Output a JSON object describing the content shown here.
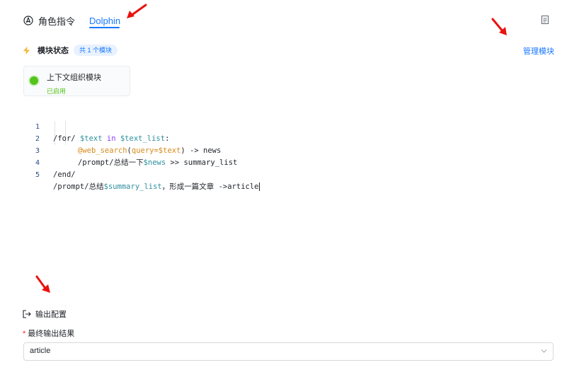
{
  "tabs": {
    "role_label": "角色指令",
    "dolphin_label": "Dolphin"
  },
  "modules": {
    "title": "模块状态",
    "badge": "共 1 个模块",
    "manage_label": "管理模块",
    "card": {
      "name": "上下文组织模块",
      "status": "已启用"
    }
  },
  "code": {
    "lines": [
      {
        "num": "1"
      },
      {
        "num": "2"
      },
      {
        "num": "3"
      },
      {
        "num": "4"
      },
      {
        "num": "5"
      }
    ],
    "l1": {
      "a": "/for/ ",
      "b": "$text",
      "c": " ",
      "d": "in",
      "e": " ",
      "f": "$text_list",
      "g": ":"
    },
    "l2": {
      "a": "@web_search",
      "b": "(",
      "c": "query=$text",
      "d": ")",
      "e": " -> news"
    },
    "l3": {
      "a": "/prompt/总结一下",
      "b": "$news",
      "c": " >> summary_list"
    },
    "l4": {
      "a": "/end/"
    },
    "l5": {
      "a": "/prompt/总结",
      "b": "$summary_list",
      "c": "，形成一篇文章 ->article"
    }
  },
  "output": {
    "heading": "输出配置",
    "required_mark": "*",
    "field_label": "最终输出结果",
    "selected_value": "article"
  },
  "colors": {
    "accent": "#1677ff",
    "success": "#52c41a",
    "annotation_arrow": "#e8130f"
  },
  "icons": [
    "role-icon",
    "document-icon",
    "lightning-icon",
    "status-dot-icon",
    "output-config-icon",
    "chevron-down-icon"
  ]
}
